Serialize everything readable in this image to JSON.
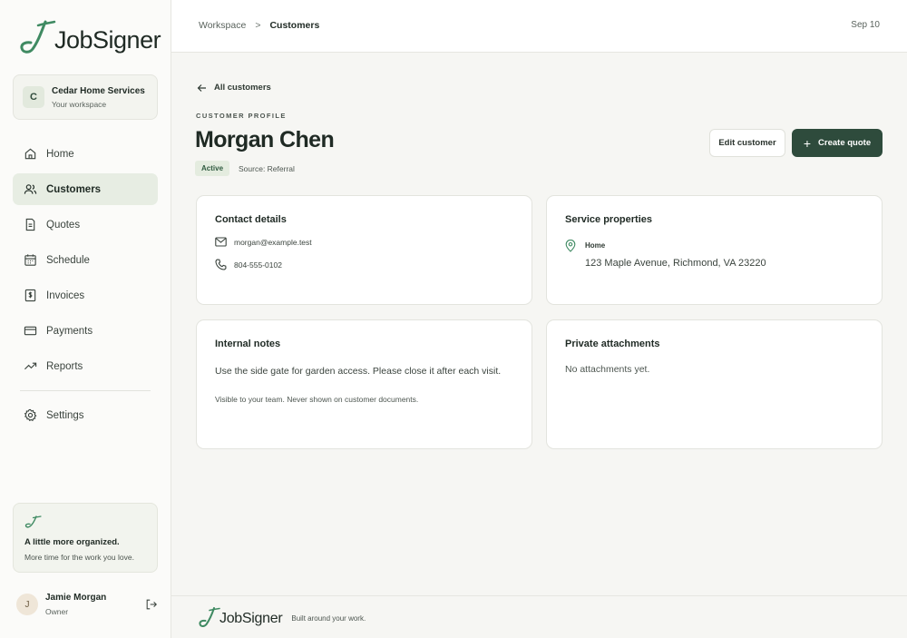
{
  "brand": {
    "name": "JobSigner",
    "accent": "#3f8a62",
    "primary": "#2e4b3c"
  },
  "workspace": {
    "initial": "C",
    "name": "Cedar Home Services",
    "subtitle": "Your workspace"
  },
  "nav": {
    "items": [
      {
        "label": "Home",
        "icon": "home-icon"
      },
      {
        "label": "Customers",
        "icon": "users-icon",
        "active": true
      },
      {
        "label": "Quotes",
        "icon": "document-icon"
      },
      {
        "label": "Schedule",
        "icon": "calendar-icon"
      },
      {
        "label": "Invoices",
        "icon": "invoice-icon"
      },
      {
        "label": "Payments",
        "icon": "credit-card-icon"
      },
      {
        "label": "Reports",
        "icon": "trend-icon"
      },
      {
        "label": "Settings",
        "icon": "gear-icon"
      }
    ]
  },
  "promo": {
    "title": "A little more organized.",
    "subtitle": "More time for the work you love."
  },
  "user": {
    "initial": "J",
    "name": "Jamie Morgan",
    "role": "Owner"
  },
  "topbar": {
    "breadcrumb": [
      "Workspace",
      "Customers"
    ],
    "separator": ">",
    "date": "Sep 10"
  },
  "page": {
    "back_label": "All customers",
    "eyebrow": "CUSTOMER PROFILE",
    "customer_name": "Morgan Chen",
    "status": "Active",
    "source": "Source: Referral",
    "edit_label": "Edit customer",
    "create_label": "Create quote"
  },
  "contact": {
    "title": "Contact details",
    "email": "morgan@example.test",
    "phone": "804-555-0102"
  },
  "properties": {
    "title": "Service properties",
    "label": "Home",
    "address": "123 Maple Avenue, Richmond, VA 23220"
  },
  "notes": {
    "title": "Internal notes",
    "text": "Use the side gate for garden access. Please close it after each visit.",
    "hint": "Visible to your team. Never shown on customer documents."
  },
  "attachments": {
    "title": "Private attachments",
    "empty": "No attachments yet."
  },
  "footer": {
    "brand": "JobSigner",
    "tagline": "Built around your work."
  }
}
